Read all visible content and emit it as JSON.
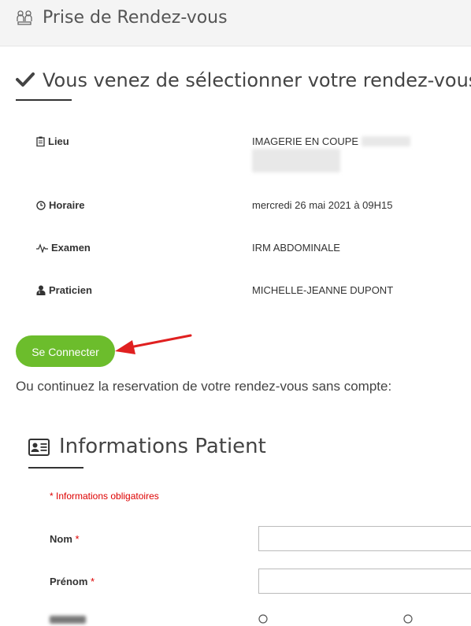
{
  "header": {
    "title": "Prise de Rendez-vous",
    "logo_icon": "doctor-patient-icon"
  },
  "selection": {
    "title": "Vous venez de sélectionner votre rendez-vous",
    "rows": [
      {
        "icon": "clipboard-icon",
        "label": "Lieu",
        "value": "IMAGERIE EN COUPE"
      },
      {
        "icon": "clock-icon",
        "label": "Horaire",
        "value": "mercredi 26 mai 2021 à 09H15"
      },
      {
        "icon": "heartbeat-icon",
        "label": "Examen",
        "value": "IRM ABDOMINALE"
      },
      {
        "icon": "doctor-icon",
        "label": "Praticien",
        "value": "MICHELLE-JEANNE DUPONT"
      }
    ]
  },
  "connect_button": "Se Connecter",
  "continue_text": "Ou continuez la reservation de votre rendez-vous sans compte:",
  "patient_info": {
    "title": "Informations Patient",
    "required_note": "* Informations obligatoires",
    "fields": [
      {
        "label": "Nom",
        "required_mark": "*",
        "value": ""
      },
      {
        "label": "Prénom",
        "required_mark": "*",
        "value": ""
      }
    ]
  },
  "colors": {
    "accent_green": "#6cbd2c",
    "required_red": "#dd0000",
    "arrow_red": "#e02020"
  }
}
